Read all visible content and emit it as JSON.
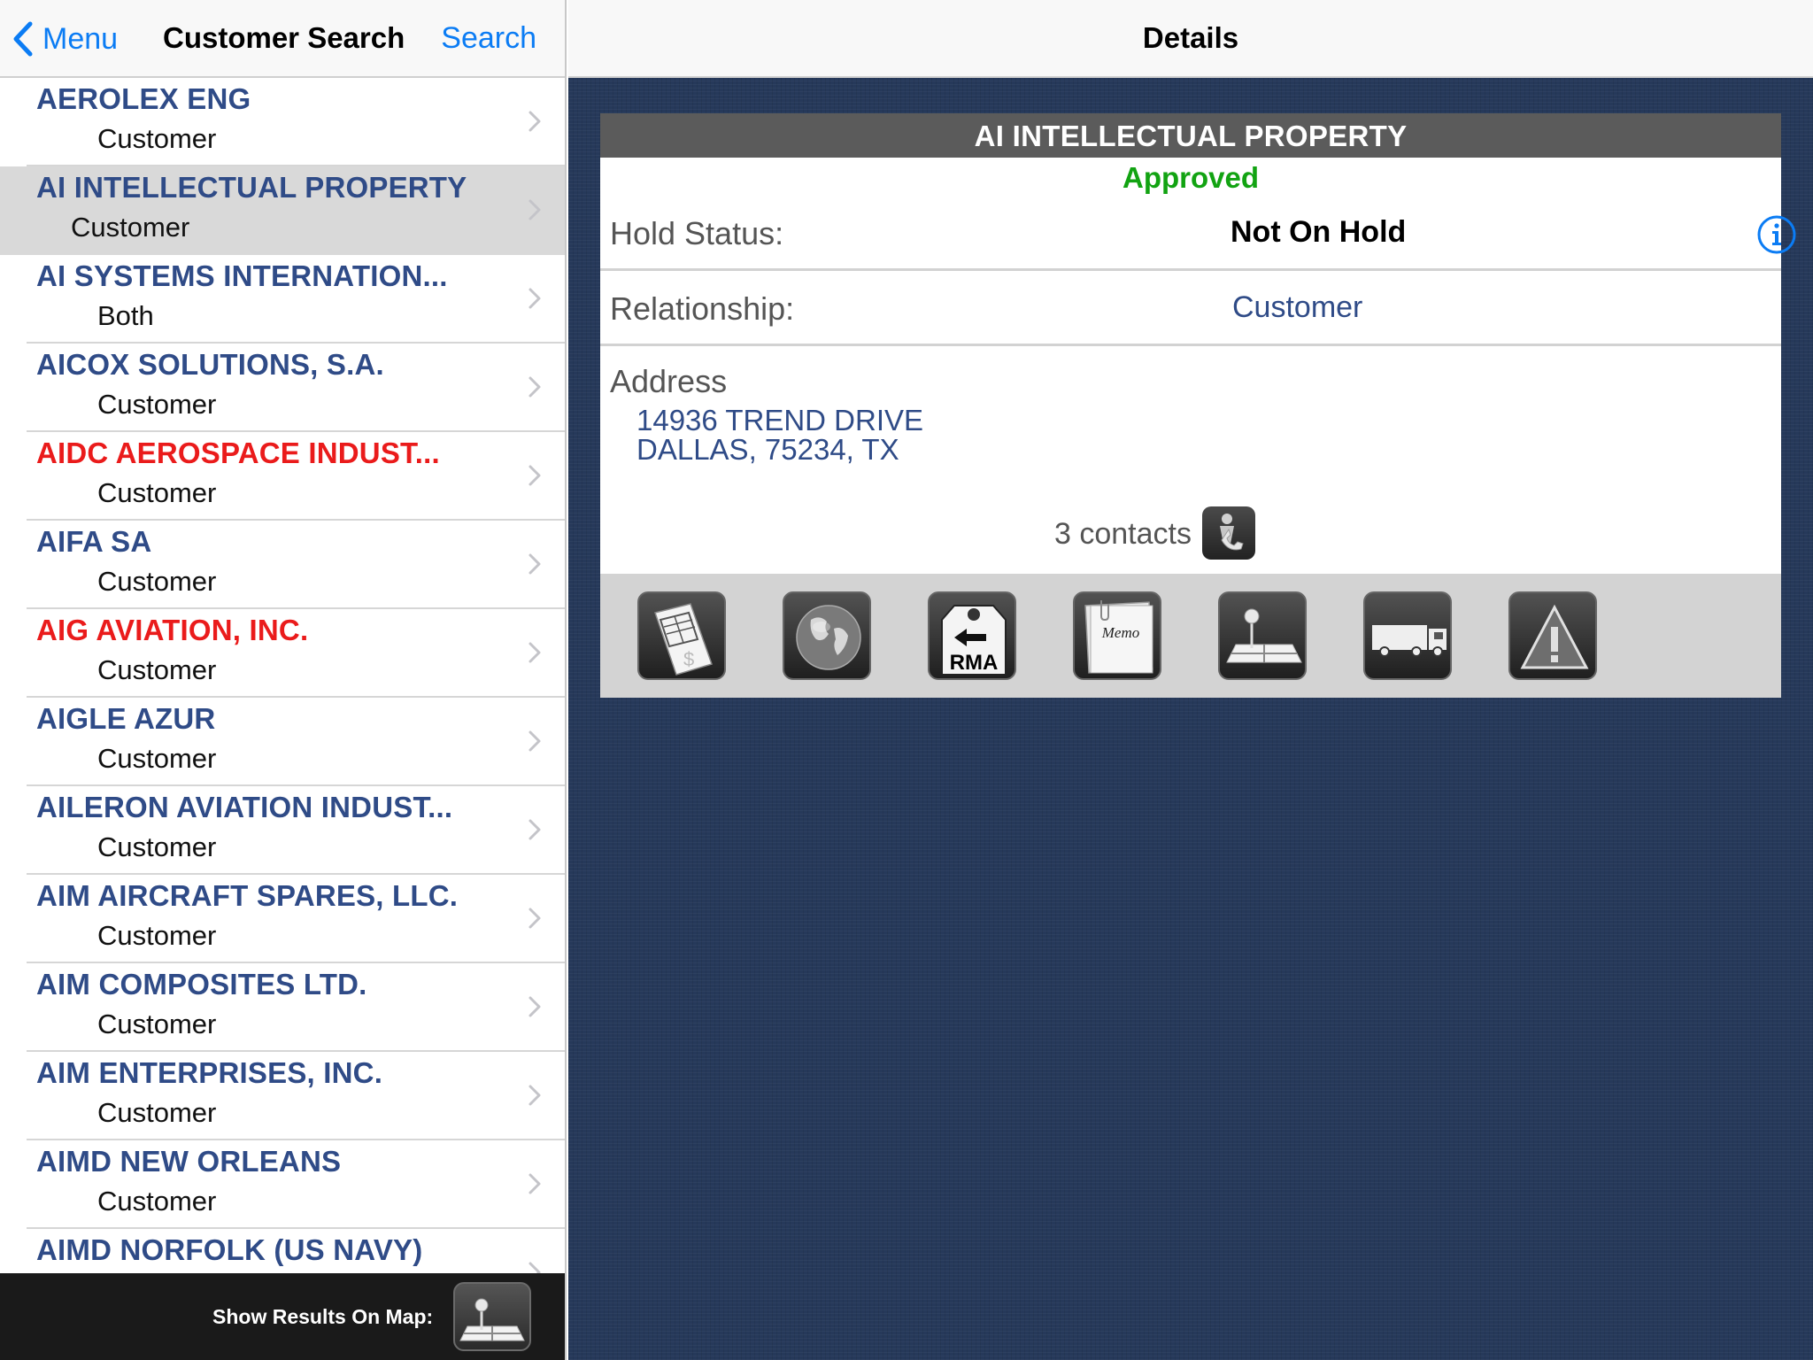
{
  "left_nav": {
    "back_label": "Menu",
    "title": "Customer Search",
    "search_label": "Search"
  },
  "customers": [
    {
      "name": "AEROLEX ENG",
      "relationship": "Customer",
      "alert": false
    },
    {
      "name": "AI INTELLECTUAL PROPERTY",
      "relationship": "Customer",
      "alert": false,
      "selected": true
    },
    {
      "name": "AI SYSTEMS INTERNATION...",
      "relationship": "Both",
      "alert": false
    },
    {
      "name": "AICOX SOLUTIONS, S.A.",
      "relationship": "Customer",
      "alert": false
    },
    {
      "name": "AIDC  AEROSPACE INDUST...",
      "relationship": "Customer",
      "alert": true
    },
    {
      "name": "AIFA SA",
      "relationship": "Customer",
      "alert": false
    },
    {
      "name": "AIG AVIATION, INC.",
      "relationship": "Customer",
      "alert": true
    },
    {
      "name": "AIGLE AZUR",
      "relationship": "Customer",
      "alert": false
    },
    {
      "name": "AILERON AVIATION INDUST...",
      "relationship": "Customer",
      "alert": false
    },
    {
      "name": "AIM AIRCRAFT SPARES, LLC.",
      "relationship": "Customer",
      "alert": false
    },
    {
      "name": "AIM COMPOSITES LTD.",
      "relationship": "Customer",
      "alert": false
    },
    {
      "name": "AIM ENTERPRISES, INC.",
      "relationship": "Customer",
      "alert": false
    },
    {
      "name": "AIMD NEW ORLEANS",
      "relationship": "Customer",
      "alert": false
    },
    {
      "name": "AIMD NORFOLK (US NAVY)",
      "relationship": "",
      "alert": false
    }
  ],
  "bottom_bar": {
    "map_label": "Show Results On Map:"
  },
  "details": {
    "nav_title": "Details",
    "company": "AI INTELLECTUAL PROPERTY",
    "approval_status": "Approved",
    "hold_status_label": "Hold Status:",
    "hold_status_value": "Not On Hold",
    "relationship_label": "Relationship:",
    "relationship_value": "Customer",
    "address_label": "Address",
    "address_line1": "14936 TREND DRIVE",
    "address_line2": "DALLAS, 75234, TX",
    "contacts_label": "3 contacts"
  },
  "toolbar": {
    "rma_label": "RMA",
    "memo_label": "Memo",
    "items": [
      "invoice-icon",
      "globe-icon",
      "rma-icon",
      "memo-icon",
      "map-icon",
      "truck-icon",
      "warning-icon"
    ]
  },
  "colors": {
    "accent_blue": "#0b7cf4",
    "name_blue": "#2f4b87",
    "alert_red": "#ea1b1b",
    "approved_green": "#12a312",
    "background_navy": "#26395a"
  }
}
